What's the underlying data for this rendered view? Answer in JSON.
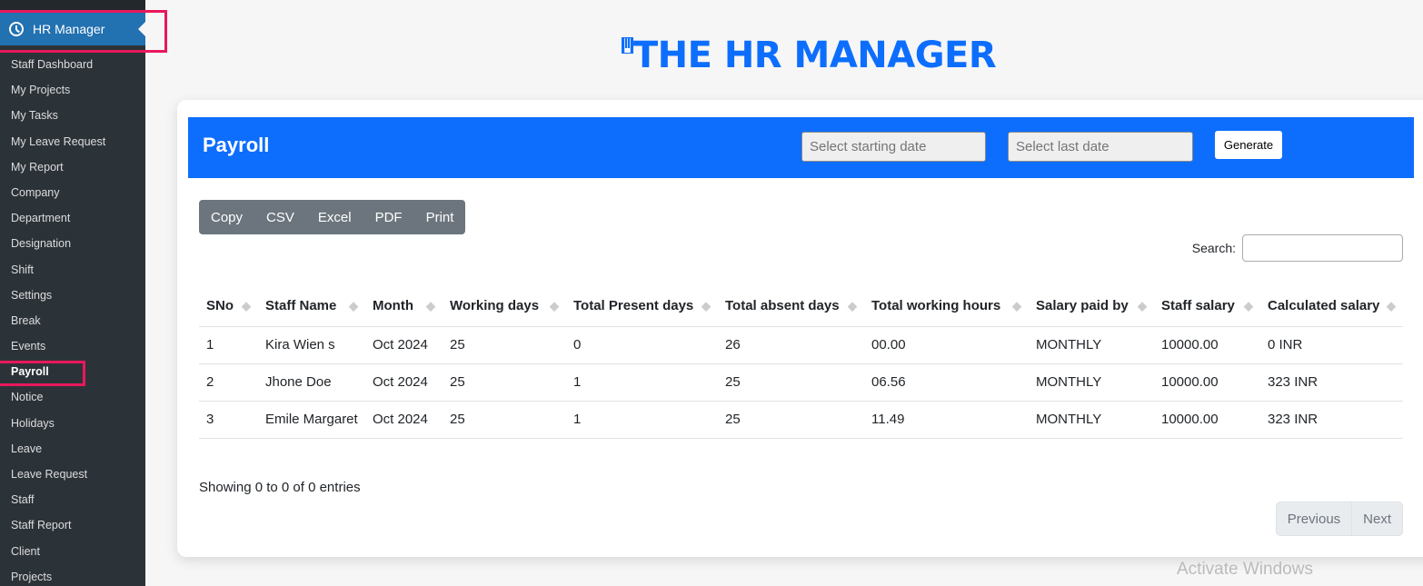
{
  "sidebar": {
    "header_label": "HR Manager",
    "items": [
      {
        "label": "Staff Dashboard"
      },
      {
        "label": "My Projects"
      },
      {
        "label": "My Tasks"
      },
      {
        "label": "My Leave Request"
      },
      {
        "label": "My Report"
      },
      {
        "label": "Company"
      },
      {
        "label": "Department"
      },
      {
        "label": "Designation"
      },
      {
        "label": "Shift"
      },
      {
        "label": "Settings"
      },
      {
        "label": "Break"
      },
      {
        "label": "Events"
      },
      {
        "label": "Payroll",
        "active": true
      },
      {
        "label": "Notice"
      },
      {
        "label": "Holidays"
      },
      {
        "label": "Leave"
      },
      {
        "label": "Leave Request"
      },
      {
        "label": "Staff"
      },
      {
        "label": "Staff Report"
      },
      {
        "label": "Client"
      },
      {
        "label": "Projects"
      }
    ]
  },
  "page": {
    "title": "THE HR MANAGER",
    "accent_color": "#0d6efd",
    "highlight_color": "#e8185c"
  },
  "card": {
    "title": "Payroll",
    "start_date_placeholder": "Select starting date",
    "end_date_placeholder": "Select last date",
    "generate_label": "Generate"
  },
  "export_buttons": [
    "Copy",
    "CSV",
    "Excel",
    "PDF",
    "Print"
  ],
  "search": {
    "label": "Search:",
    "value": ""
  },
  "table": {
    "columns": [
      "SNo",
      "Staff Name",
      "Month",
      "Working days",
      "Total Present days",
      "Total absent days",
      "Total working hours",
      "Salary paid by",
      "Staff salary",
      "Calculated salary"
    ],
    "rows": [
      [
        "1",
        "Kira Wien s",
        "Oct 2024",
        "25",
        "0",
        "26",
        "00.00",
        "MONTHLY",
        "10000.00",
        "0 INR"
      ],
      [
        "2",
        "Jhone Doe",
        "Oct 2024",
        "25",
        "1",
        "25",
        "06.56",
        "MONTHLY",
        "10000.00",
        "323 INR"
      ],
      [
        "3",
        "Emile Margaret",
        "Oct 2024",
        "25",
        "1",
        "25",
        "11.49",
        "MONTHLY",
        "10000.00",
        "323 INR"
      ]
    ]
  },
  "footer": {
    "info": "Showing 0 to 0 of 0 entries",
    "previous_label": "Previous",
    "next_label": "Next"
  },
  "watermark": "Activate Windows"
}
